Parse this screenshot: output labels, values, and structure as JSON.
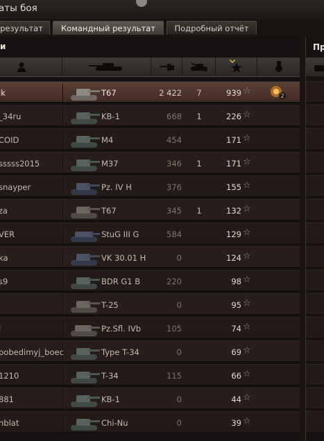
{
  "window": {
    "title": "аты боя"
  },
  "tabs": [
    {
      "label": "результат",
      "active": false
    },
    {
      "label": "Командный результат",
      "active": true
    },
    {
      "label": "Подробный отчёт",
      "active": false
    }
  ],
  "panel": {
    "label": "и"
  },
  "right_panel": {
    "label": "Пр"
  },
  "columns": {
    "player_icon": "person-icon",
    "tank_icon": "tank-icon",
    "damage_icon": "damage-gun-icon",
    "frags_icon": "destroyed-tank-icon",
    "xp_icon": "star-icon",
    "medal_icon": "medal-icon",
    "sort_indicator": "chevron-down-icon"
  },
  "star_symbol": "☆",
  "rows": [
    {
      "player": "ik",
      "tank": "T67",
      "damage": "2 422",
      "frags": "7",
      "xp": "939",
      "medal_count": "2",
      "highlight": true
    },
    {
      "player": "_34ru",
      "tank": "KB-1",
      "damage": "668",
      "frags": "1",
      "xp": "226"
    },
    {
      "player": "COID",
      "tank": "M4",
      "damage": "454",
      "frags": "",
      "xp": "171"
    },
    {
      "player": "sssss2015",
      "tank": "M37",
      "damage": "346",
      "frags": "1",
      "xp": "171"
    },
    {
      "player": "snayper",
      "tank": "Pz. IV H",
      "damage": "376",
      "frags": "",
      "xp": "155"
    },
    {
      "player": "za",
      "tank": "T67",
      "damage": "345",
      "frags": "1",
      "xp": "132"
    },
    {
      "player": "VER",
      "tank": "StuG III G",
      "damage": "584",
      "frags": "",
      "xp": "129"
    },
    {
      "player": "ka",
      "tank": "VK 30.01 H",
      "damage": "0",
      "frags": "",
      "xp": "124"
    },
    {
      "player": "s9",
      "tank": "BDR G1 B",
      "damage": "220",
      "frags": "",
      "xp": "98"
    },
    {
      "player": "",
      "tank": "T-25",
      "damage": "0",
      "frags": "",
      "xp": "95"
    },
    {
      "player": "l",
      "tank": "Pz.Sfl. IVb",
      "damage": "105",
      "frags": "",
      "xp": "74"
    },
    {
      "player": "pobedimyj_boec",
      "tank": "Type T-34",
      "damage": "0",
      "frags": "",
      "xp": "69"
    },
    {
      "player": "1210",
      "tank": "T-34",
      "damage": "115",
      "frags": "",
      "xp": "66"
    },
    {
      "player": "881",
      "tank": "KB-1",
      "damage": "0",
      "frags": "",
      "xp": "44"
    },
    {
      "player": "nblat",
      "tank": "Chi-Nu",
      "damage": "0",
      "frags": "",
      "xp": "39"
    }
  ]
}
